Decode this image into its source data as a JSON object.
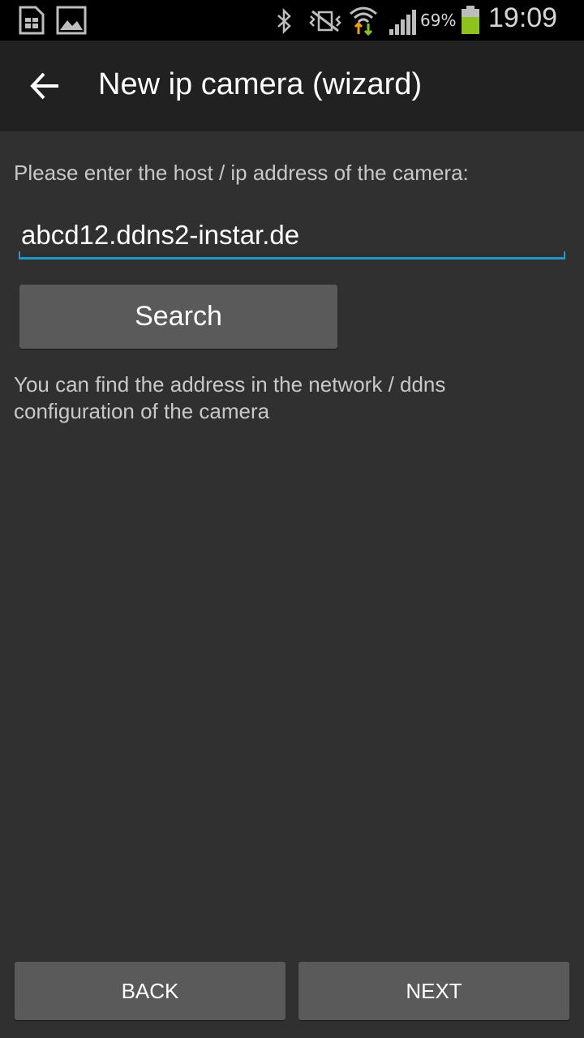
{
  "status_bar": {
    "battery_percent": "69%",
    "time": "19:09",
    "icons": [
      "sim-card-icon",
      "image-icon",
      "bluetooth-icon",
      "vibrate-mute-icon",
      "wifi-icon",
      "signal-icon",
      "battery-icon"
    ],
    "battery_color": "#8dc21f"
  },
  "action_bar": {
    "title": "New ip camera (wizard)"
  },
  "form": {
    "prompt": "Please enter the host / ip address of the camera:",
    "host_value": "abcd12.ddns2-instar.de",
    "search_label": "Search",
    "hint": "You can find the address in the network / ddns configuration of the camera"
  },
  "footer": {
    "back_label": "BACK",
    "next_label": "NEXT"
  },
  "colors": {
    "background": "#303030",
    "action_bar": "#212121",
    "accent": "#1e97c9",
    "button": "#5a5a5a"
  }
}
